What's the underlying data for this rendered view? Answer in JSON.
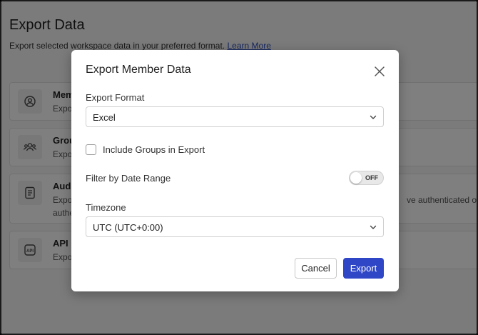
{
  "page": {
    "title": "Export Data",
    "subtitle": "Export selected workspace data in your preferred format.",
    "learn_more": "Learn More"
  },
  "cards": [
    {
      "title": "Mem",
      "desc": "Expo",
      "icon": "user-circle-icon"
    },
    {
      "title": "Grou",
      "desc": "Expo",
      "icon": "users-icon"
    },
    {
      "title": "Audit",
      "desc_line1": "Expo",
      "desc_line1_right": "ve authenticated or fa",
      "desc_line2": "authe",
      "icon": "document-icon"
    },
    {
      "title": "API U",
      "desc": "Expo",
      "icon": "api-icon"
    }
  ],
  "modal": {
    "title": "Export Member Data",
    "format_label": "Export Format",
    "format_value": "Excel",
    "include_groups_label": "Include Groups in Export",
    "date_range_label": "Filter by Date Range",
    "toggle_state": "OFF",
    "timezone_label": "Timezone",
    "timezone_value": "UTC (UTC+0:00)",
    "cancel_label": "Cancel",
    "export_label": "Export"
  },
  "colors": {
    "accent": "#2f46c6",
    "link": "#2f4fbf"
  }
}
